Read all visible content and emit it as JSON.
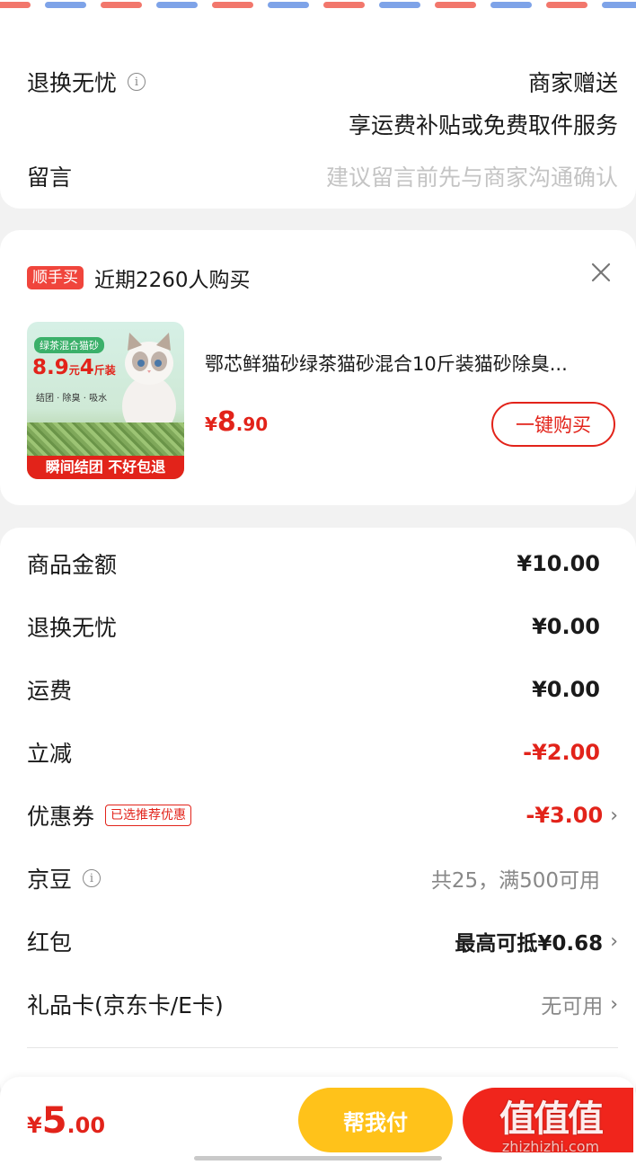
{
  "return_section": {
    "return_label": "退换无忧",
    "return_value": "商家赠送",
    "return_desc": "享运费补贴或免费取件服务",
    "message_label": "留言",
    "message_placeholder": "建议留言前先与商家沟通确认"
  },
  "recommend": {
    "tag": "顺手买",
    "headline": "近期2260人购买",
    "close_icon": "close-icon",
    "product": {
      "image_badge": "绿茶混合猫砂",
      "image_price_main": "8.9",
      "image_price_unit": "元",
      "image_weight": "4",
      "image_weight_unit": "斤装",
      "image_features": "结团 · 除臭 · 吸水",
      "image_banner": "瞬间结团 不好包退",
      "title": "鄂芯鲜猫砂绿茶猫砂混合10斤装猫砂除臭...",
      "price_symbol": "¥",
      "price_int": "8",
      "price_dec": ".90",
      "buy_button": "一键购买"
    }
  },
  "summary": {
    "rows": [
      {
        "label": "商品金额",
        "value": "¥10.00"
      },
      {
        "label": "退换无忧",
        "value": "¥0.00"
      },
      {
        "label": "运费",
        "value": "¥0.00"
      },
      {
        "label": "立减",
        "value": "-¥2.00"
      },
      {
        "label": "优惠券",
        "tag": "已选推荐优惠",
        "value": "-¥3.00"
      },
      {
        "label": "京豆",
        "value": "共25，满500可用"
      },
      {
        "label": "红包",
        "value": "最高可抵¥0.68"
      },
      {
        "label": "礼品卡(京东卡/E卡)",
        "value": "无可用"
      }
    ]
  },
  "footer": {
    "price_symbol": "¥",
    "price_int": "5",
    "price_dec": ".00",
    "help_pay_button": "帮我付",
    "watermark_text": "值值值",
    "watermark_domain": "zhizhizhi.com"
  },
  "colors": {
    "accent_red": "#e2231a",
    "yellow_button": "#ffc21a",
    "red_button": "#f0251c"
  }
}
